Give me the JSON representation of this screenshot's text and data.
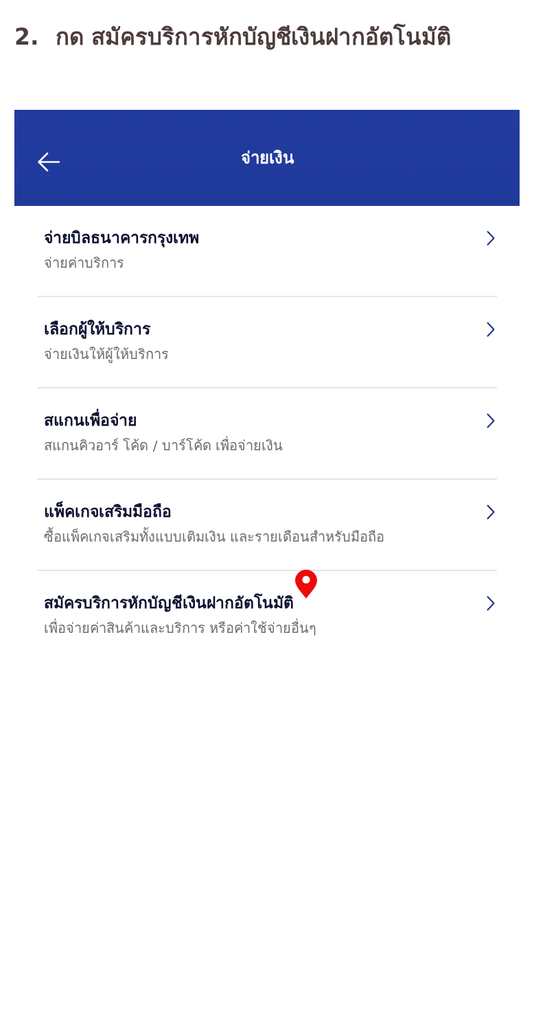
{
  "instruction": {
    "number": "2.",
    "text": "กด สมัครบริการหักบัญชีเงินฝากอัตโนมัติ"
  },
  "app_bar": {
    "title": "จ่ายเงิน"
  },
  "menu_items": [
    {
      "title": "จ่ายบิลธนาคารกรุงเทพ",
      "subtitle": "จ่ายค่าบริการ",
      "pin_marker": false
    },
    {
      "title": "เลือกผู้ให้บริการ",
      "subtitle": "จ่ายเงินให้ผู้ให้บริการ",
      "pin_marker": false
    },
    {
      "title": "สแกนเพื่อจ่าย",
      "subtitle": "สแกนคิวอาร์ โค้ด / บาร์โค้ด เพื่อจ่ายเงิน",
      "pin_marker": false
    },
    {
      "title": "แพ็คเกจเสริมมือถือ",
      "subtitle": "ซื้อแพ็คเกจเสริมทั้งแบบเติมเงิน และรายเดือนสำหรับมือถือ",
      "pin_marker": false
    },
    {
      "title": "สมัครบริการหักบัญชีเงินฝากอัตโนมัติ",
      "subtitle": "เพื่อจ่ายค่าสินค้าและบริการ หรือค่าใช้จ่ายอื่นๆ",
      "pin_marker": true
    }
  ]
}
